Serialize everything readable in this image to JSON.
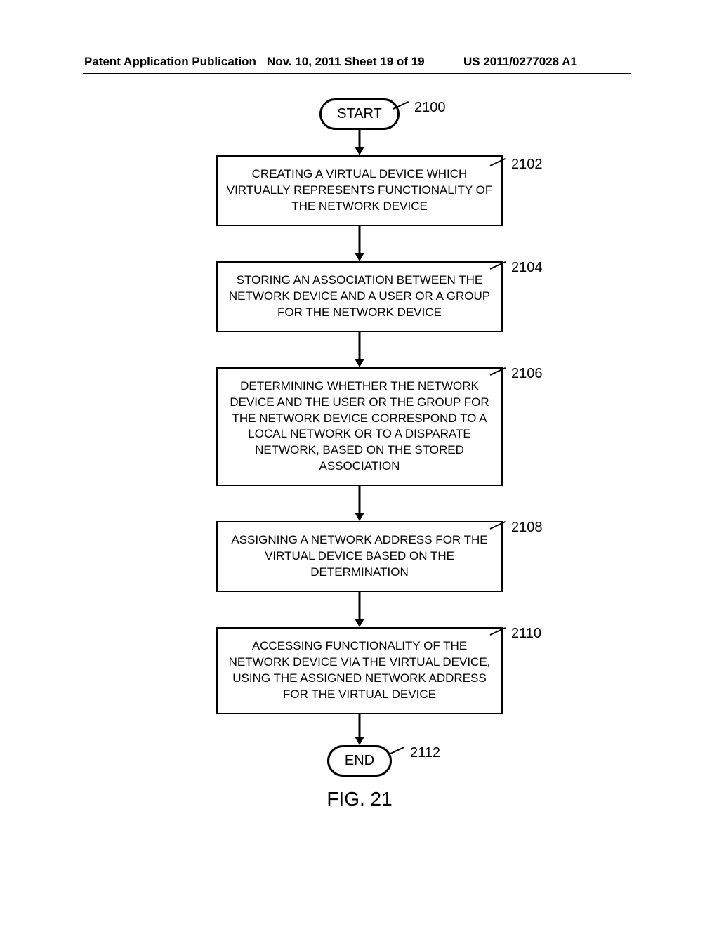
{
  "header": {
    "left": "Patent Application Publication",
    "mid": "Nov. 10, 2011  Sheet 19 of 19",
    "right": "US 2011/0277028 A1"
  },
  "fig": {
    "label": "FIG. 21"
  },
  "nodes": {
    "start": {
      "text": "START",
      "ref": "2100"
    },
    "s2102": {
      "ref": "2102",
      "text": "CREATING A VIRTUAL DEVICE WHICH VIRTUALLY REPRESENTS FUNCTIONALITY OF THE NETWORK DEVICE"
    },
    "s2104": {
      "ref": "2104",
      "text": "STORING AN ASSOCIATION BETWEEN THE NETWORK DEVICE AND A USER OR A GROUP FOR THE NETWORK DEVICE"
    },
    "s2106": {
      "ref": "2106",
      "text": "DETERMINING WHETHER THE NETWORK DEVICE AND THE USER OR THE GROUP FOR THE NETWORK DEVICE CORRESPOND TO A LOCAL NETWORK OR TO A DISPARATE NETWORK, BASED ON THE STORED ASSOCIATION"
    },
    "s2108": {
      "ref": "2108",
      "text": "ASSIGNING A NETWORK ADDRESS FOR THE VIRTUAL DEVICE BASED ON THE DETERMINATION"
    },
    "s2110": {
      "ref": "2110",
      "text": "ACCESSING FUNCTIONALITY OF THE NETWORK DEVICE VIA THE VIRTUAL DEVICE, USING THE ASSIGNED NETWORK ADDRESS FOR THE VIRTUAL DEVICE"
    },
    "end": {
      "text": "END",
      "ref": "2112"
    }
  }
}
